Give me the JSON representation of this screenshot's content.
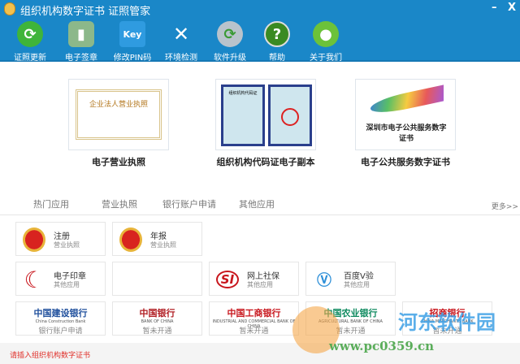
{
  "window": {
    "title": "组织机构数字证书  证照管家",
    "minimize": "–",
    "close": "X"
  },
  "toolbar": [
    {
      "label": "证照更新",
      "icon": "refresh-icon"
    },
    {
      "label": "电子签章",
      "icon": "stamp-icon"
    },
    {
      "label": "修改PIN码",
      "icon": "key-icon"
    },
    {
      "label": "环境检测",
      "icon": "tools-icon"
    },
    {
      "label": "软件升级",
      "icon": "gear-update-icon"
    },
    {
      "label": "帮助",
      "icon": "help-icon"
    },
    {
      "label": "关于我们",
      "icon": "users-icon"
    }
  ],
  "certificates": [
    {
      "label": "电子营业执照",
      "image_text": "企业法人营业执照"
    },
    {
      "label": "组织机构代码证电子副本",
      "image_text": "组织机构代码证"
    },
    {
      "label": "电子公共服务数字证书",
      "image_text": "深圳市电子公共服务数字证书"
    }
  ],
  "tabs": [
    "热门应用",
    "营业执照",
    "银行账户申请",
    "其他应用"
  ],
  "more": "更多>>",
  "apps": [
    {
      "name": "注册",
      "sub": "营业执照"
    },
    {
      "name": "年报",
      "sub": "营业执照"
    },
    {
      "name": "电子印章",
      "sub": "其他应用"
    },
    {
      "name": "网上社保",
      "sub": "其他应用"
    },
    {
      "name": "百度V验",
      "sub": "其他应用"
    }
  ],
  "banks": [
    {
      "name": "中国建设银行",
      "en": "China Construction Bank",
      "sub": "银行账户申请",
      "color": "#1f4f9c"
    },
    {
      "name": "中国银行",
      "en": "BANK OF CHINA",
      "sub": "暂未开通",
      "color": "#b01d22"
    },
    {
      "name": "中国工商银行",
      "en": "INDUSTRIAL AND COMMERCIAL BANK OF CHINA",
      "sub": "暂未开通",
      "color": "#c8161d"
    },
    {
      "name": "中国农业银行",
      "en": "AGRICULTURAL BANK OF CHINA",
      "sub": "暂未开通",
      "color": "#0e8a5f"
    },
    {
      "name": "招商银行",
      "en": "CHINA MERCHANTS BANK",
      "sub": "暂未开通",
      "color": "#c8161d"
    }
  ],
  "status": "请插入组织机构数字证书",
  "watermark": {
    "title": "河东软件园",
    "url": "www.pc0359.cn"
  }
}
